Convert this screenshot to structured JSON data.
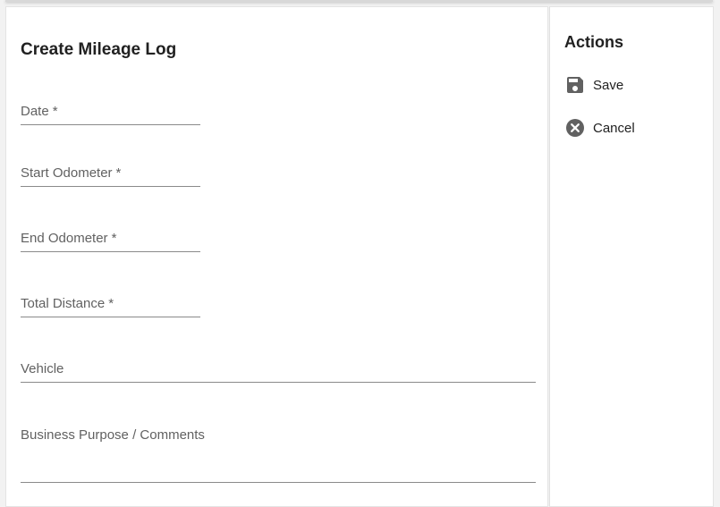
{
  "form": {
    "title": "Create Mileage Log",
    "fields": [
      {
        "label": "Date",
        "required_mark": "*",
        "value": ""
      },
      {
        "label": "Start Odometer",
        "required_mark": "*",
        "value": ""
      },
      {
        "label": "End Odometer",
        "required_mark": "*",
        "value": ""
      },
      {
        "label": "Total Distance",
        "required_mark": "*",
        "value": ""
      },
      {
        "label": "Vehicle",
        "value": ""
      },
      {
        "label": "Business Purpose / Comments",
        "value": ""
      }
    ]
  },
  "actions": {
    "title": "Actions",
    "save_label": "Save",
    "save_icon": "floppy-disk-icon",
    "cancel_label": "Cancel",
    "cancel_icon": "cancel-circle-icon"
  },
  "colors": {
    "icon": "#616161",
    "text": "#212121",
    "label": "#616161",
    "underline": "#8a8a8a"
  }
}
